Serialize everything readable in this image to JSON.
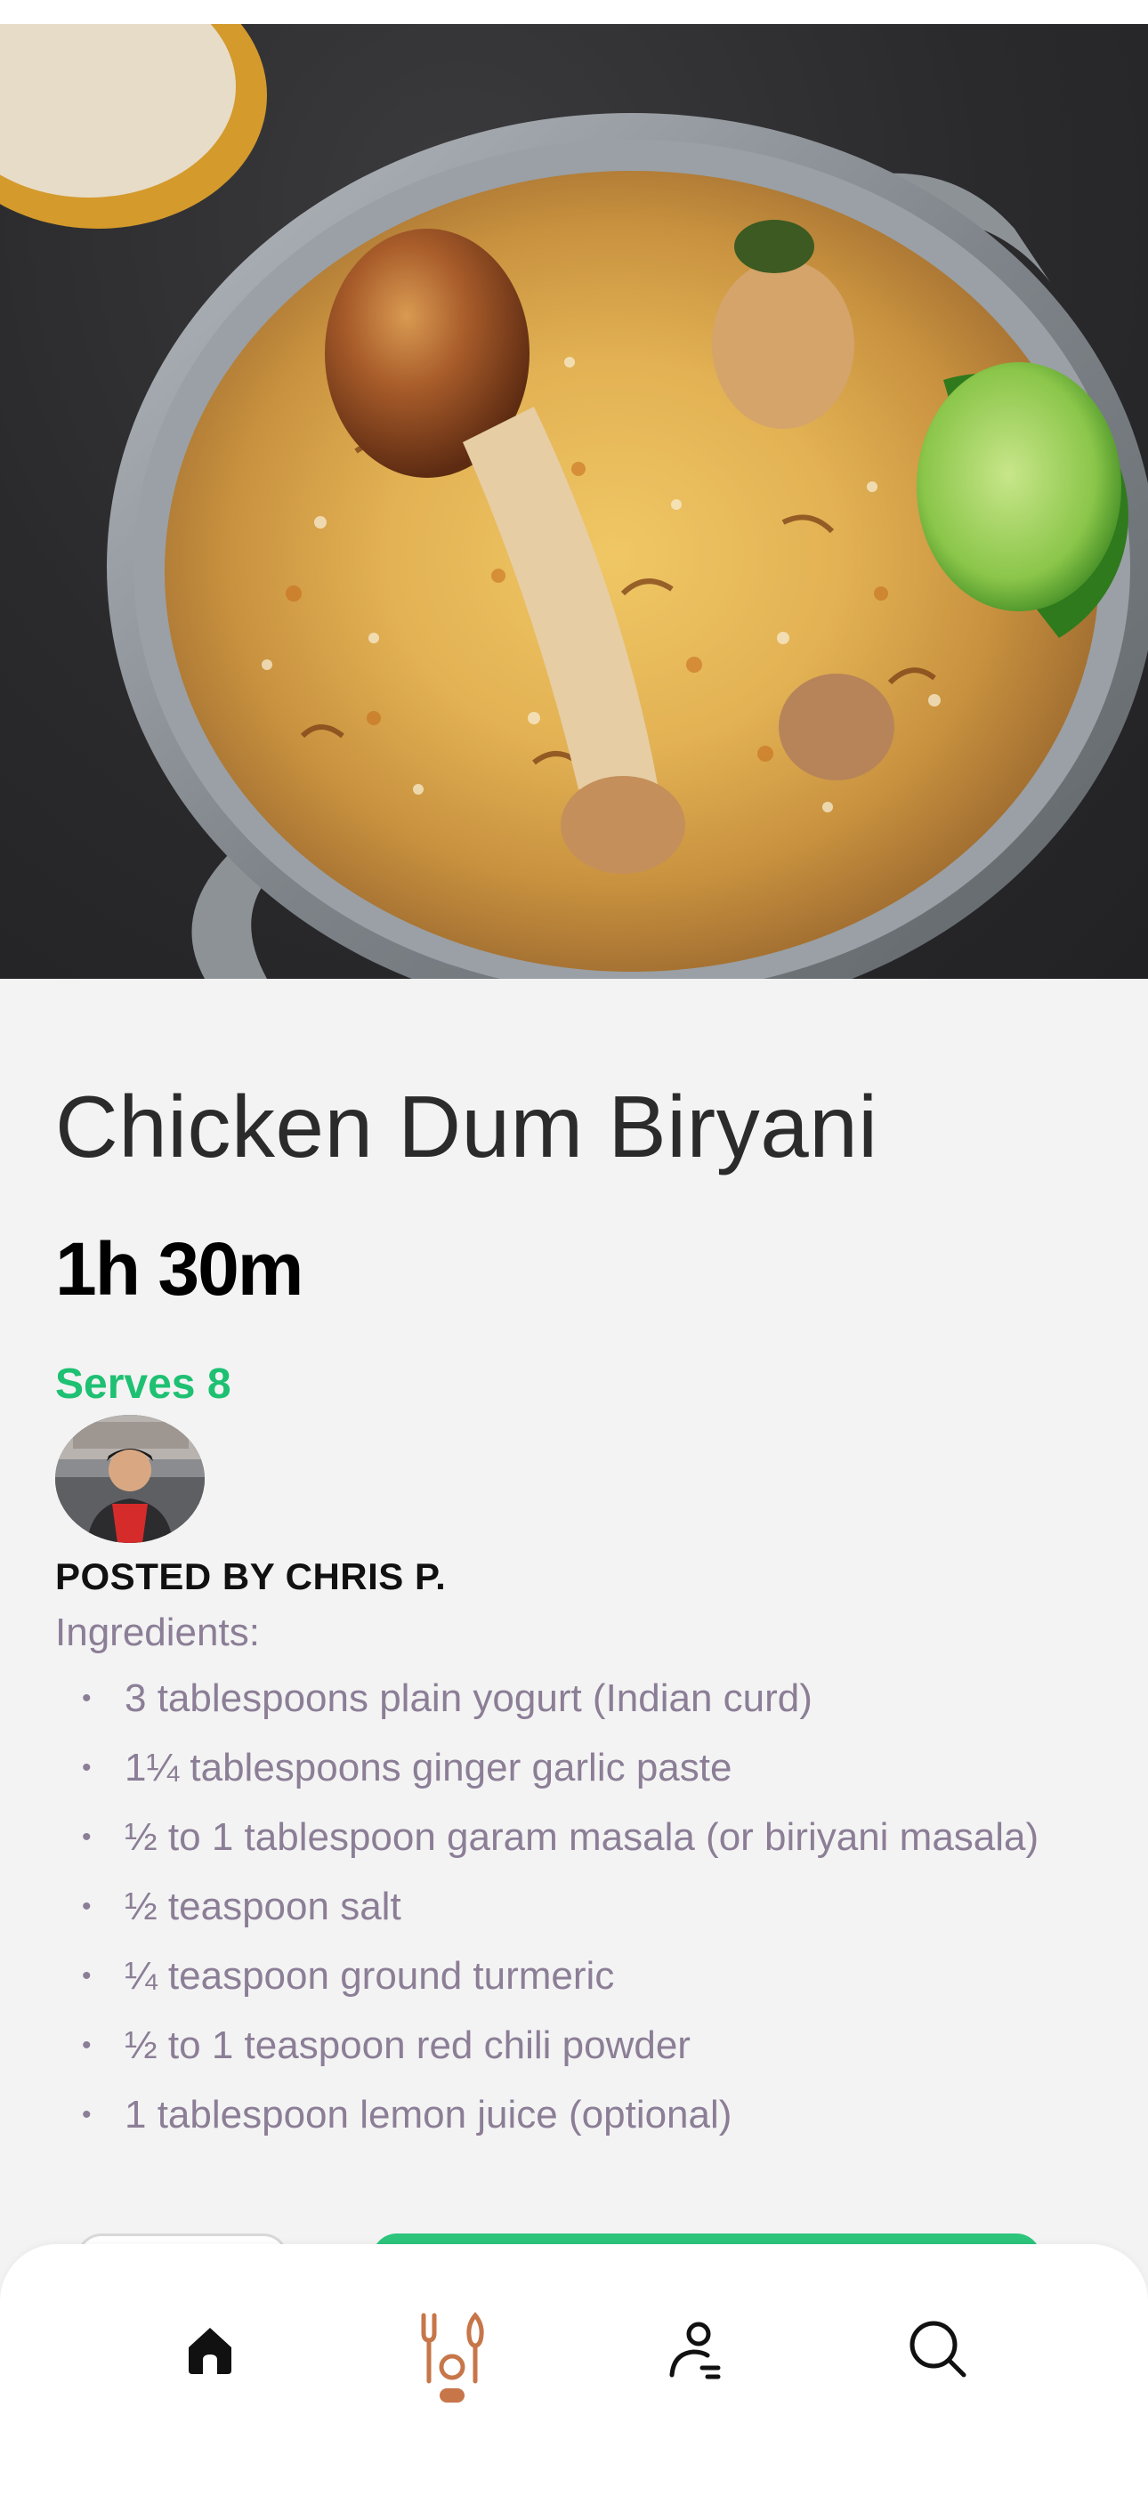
{
  "recipe": {
    "title": "Chicken Dum Biryani",
    "time": "1h 30m",
    "serves": "Serves 8",
    "posted_by": "POSTED BY CHRIS P.",
    "ingredients_label": "Ingredients:",
    "ingredients": [
      "3 tablespoons plain yogurt (Indian curd)",
      "1¼ tablespoons ginger garlic paste",
      "½ to 1 tablespoon garam masala (or biriyani masala)",
      "½ teaspoon salt",
      "¼ teaspoon ground turmeric",
      "½ to 1 teaspoon red chili powder",
      "1 tablespoon lemon juice (optional)"
    ]
  },
  "nav": {
    "items": [
      {
        "name": "home",
        "icon": "home-icon"
      },
      {
        "name": "recipes",
        "icon": "kitchen-utensils-icon",
        "active": true
      },
      {
        "name": "profile",
        "icon": "user-icon"
      },
      {
        "name": "search",
        "icon": "search-icon"
      }
    ]
  },
  "colors": {
    "accent_green": "#1ec072",
    "active_nav": "#c7764a",
    "muted_text": "#8b7e96"
  }
}
